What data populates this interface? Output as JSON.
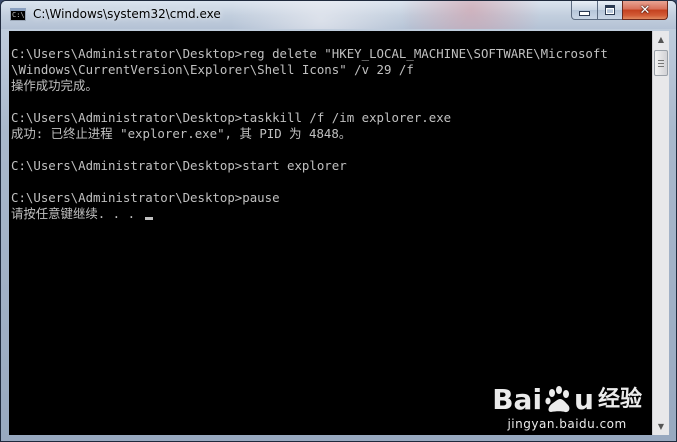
{
  "window": {
    "title": "C:\\Windows\\system32\\cmd.exe",
    "icon_text": "C:\\"
  },
  "caption_buttons": {
    "minimize": "minimize-icon",
    "maximize": "maximize-icon",
    "close_label": "✕"
  },
  "console": {
    "lines": [
      "",
      "C:\\Users\\Administrator\\Desktop>reg delete \"HKEY_LOCAL_MACHINE\\SOFTWARE\\Microsoft",
      "\\Windows\\CurrentVersion\\Explorer\\Shell Icons\" /v 29 /f",
      "操作成功完成。",
      "",
      "C:\\Users\\Administrator\\Desktop>taskkill /f /im explorer.exe",
      "成功: 已终止进程 \"explorer.exe\", 其 PID 为 4848。",
      "",
      "C:\\Users\\Administrator\\Desktop>start explorer",
      "",
      "C:\\Users\\Administrator\\Desktop>pause",
      "请按任意键继续. . . "
    ]
  },
  "watermark": {
    "brand_left": "Bai",
    "brand_right": "u",
    "brand_sub": "经验",
    "url": "jingyan.baidu.com"
  },
  "colors": {
    "console_bg": "#000000",
    "console_fg": "#c0c0c0",
    "close_red": "#c4411f"
  }
}
